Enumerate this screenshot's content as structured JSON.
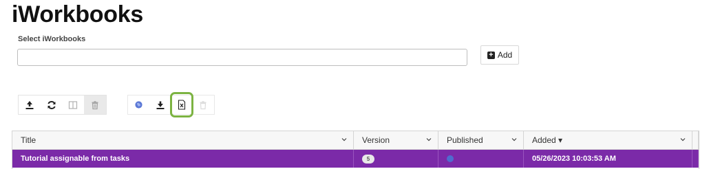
{
  "page": {
    "title": "iWorkbooks"
  },
  "selector": {
    "label": "Select iWorkbooks",
    "value": "",
    "add_label": "Add"
  },
  "toolbar_left": [
    "upload-icon",
    "refresh-icon",
    "columns-icon",
    "trash-icon"
  ],
  "toolbar_right": [
    "globe-icon",
    "download-icon",
    "excel-export-icon",
    "trash-icon"
  ],
  "grid": {
    "columns": [
      {
        "label": "Title"
      },
      {
        "label": "Version"
      },
      {
        "label": "Published"
      },
      {
        "label": "Added ▾"
      }
    ],
    "rows": [
      {
        "title": "Tutorial assignable from tasks",
        "version": "5",
        "published": "globe-icon",
        "added": "05/26/2023 10:03:53 AM",
        "selected_color": "#7b2aa8"
      }
    ]
  },
  "colors": {
    "accent": "#7b2aa8",
    "highlight": "#7cb342"
  }
}
